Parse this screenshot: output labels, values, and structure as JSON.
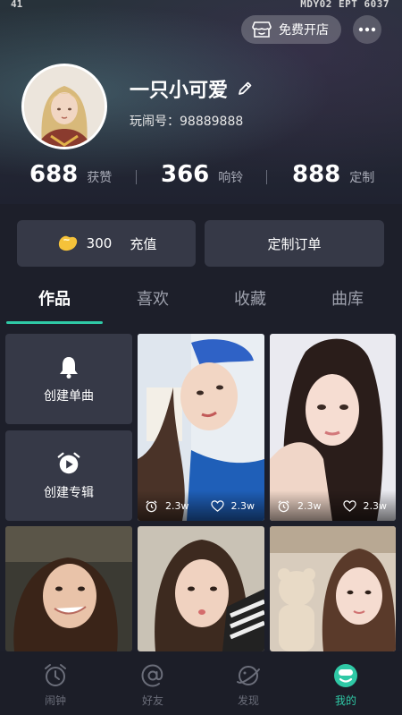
{
  "status_bar": {
    "left": "41",
    "right": "MDY02 EPT 6037"
  },
  "header": {
    "shop_button_label": "免费开店",
    "more_icon": "more-dots-icon"
  },
  "profile": {
    "name": "一只小可爱",
    "uid": "玩闹号：98889888"
  },
  "stats": [
    {
      "value": "688",
      "label": "获赞"
    },
    {
      "value": "366",
      "label": "响铃"
    },
    {
      "value": "888",
      "label": "定制"
    }
  ],
  "actions": {
    "balance": "300",
    "recharge_label": "充值",
    "custom_order_label": "定制订单"
  },
  "tabs": [
    "作品",
    "喜欢",
    "收藏",
    "曲库"
  ],
  "create": {
    "single_label": "创建单曲",
    "album_label": "创建专辑"
  },
  "works": [
    {
      "alarm_count": "2.3w",
      "like_count": "2.3w"
    },
    {
      "alarm_count": "2.3w",
      "like_count": "2.3w"
    }
  ],
  "bottom_nav": [
    {
      "label": "闹钟",
      "icon": "alarm-clock-icon"
    },
    {
      "label": "好友",
      "icon": "at-sign-icon"
    },
    {
      "label": "发现",
      "icon": "planet-icon"
    },
    {
      "label": "我的",
      "icon": "smile-face-icon"
    }
  ],
  "colors": {
    "accent": "#2fc9a6",
    "card": "#363947",
    "background": "#1d1f2a"
  }
}
